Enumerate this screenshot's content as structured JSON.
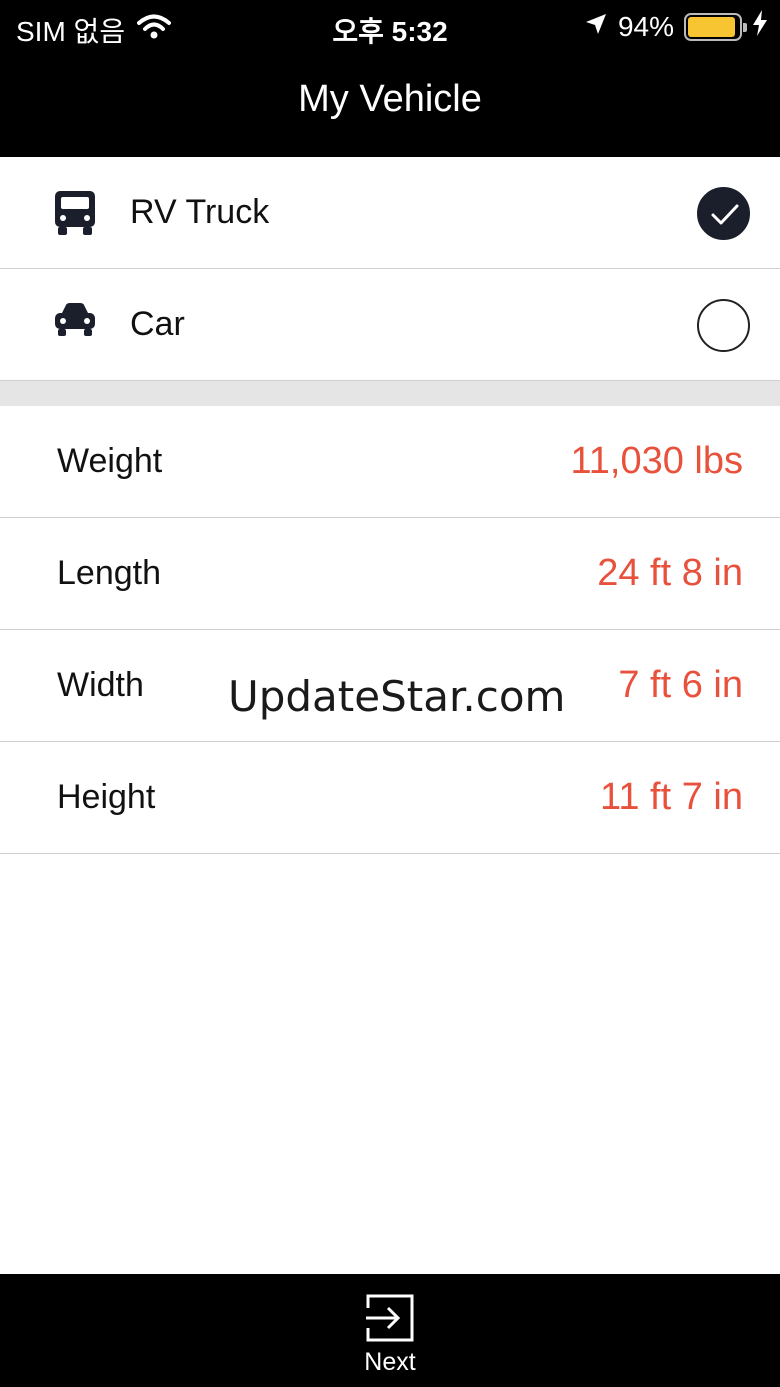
{
  "status_bar": {
    "carrier": "SIM 없음",
    "time": "오후 5:32",
    "battery_percent": "94%",
    "battery_level": 0.94,
    "icons": [
      "wifi-icon",
      "location-arrow-icon",
      "battery-icon",
      "charging-bolt-icon"
    ]
  },
  "nav": {
    "title": "My Vehicle"
  },
  "vehicle_types": [
    {
      "label": "RV Truck",
      "icon": "truck-icon",
      "selected": true
    },
    {
      "label": "Car",
      "icon": "car-icon",
      "selected": false
    }
  ],
  "dimensions": [
    {
      "label": "Weight",
      "value": "11,030 lbs"
    },
    {
      "label": "Length",
      "value": "24 ft 8 in"
    },
    {
      "label": "Width",
      "value": "7 ft 6 in"
    },
    {
      "label": "Height",
      "value": "11 ft 7 in"
    }
  ],
  "watermark": "UpdateStar.com",
  "bottom_bar": {
    "next_label": "Next",
    "icon": "next-arrow-icon"
  },
  "colors": {
    "accent_value": "#e8513c",
    "bar_background": "#000000",
    "selected_radio": "#1a1f2b",
    "battery": "#f7c531"
  }
}
